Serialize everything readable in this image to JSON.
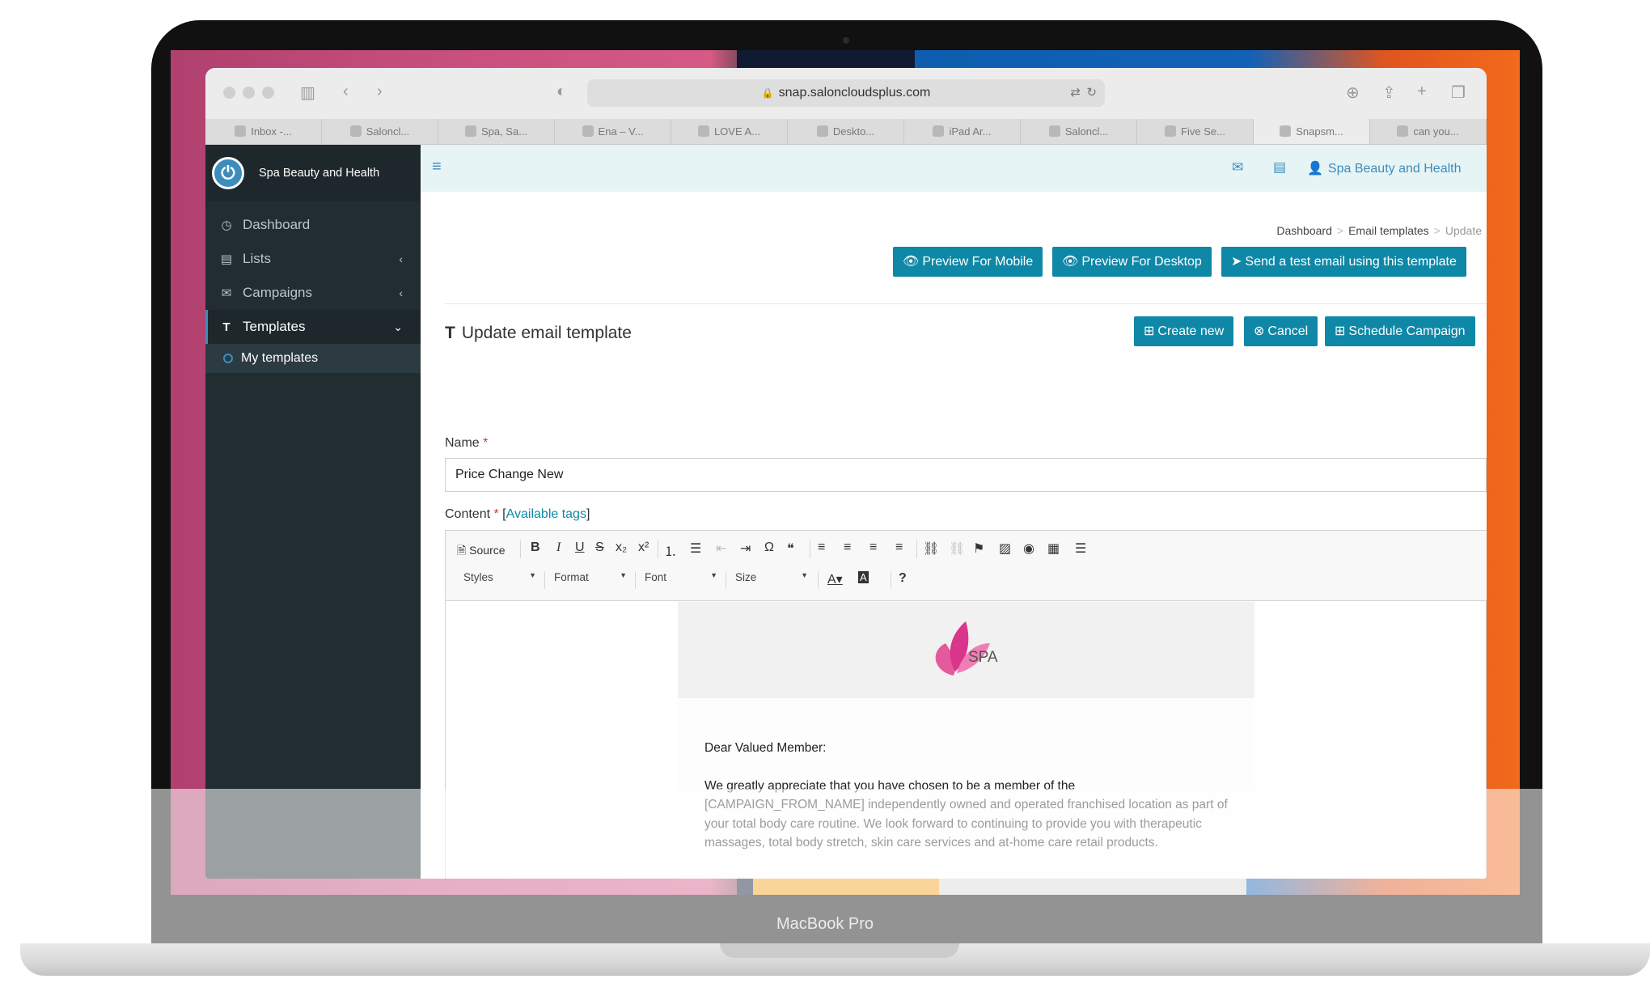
{
  "device": {
    "label": "MacBook Pro"
  },
  "browser": {
    "url": "snap.saloncloudsplus.com",
    "tabs": [
      {
        "label": "Inbox -..."
      },
      {
        "label": "Saloncl..."
      },
      {
        "label": "Spa, Sa..."
      },
      {
        "label": "Ena – V..."
      },
      {
        "label": "LOVE A..."
      },
      {
        "label": "Deskto..."
      },
      {
        "label": "iPad Ar..."
      },
      {
        "label": "Saloncl..."
      },
      {
        "label": "Five Se..."
      },
      {
        "label": "Snapsm..."
      },
      {
        "label": "can you..."
      }
    ],
    "active_tab_index": 9
  },
  "brand": {
    "name": "Spa Beauty and Health"
  },
  "sidebar": {
    "items": [
      {
        "label": "Dashboard",
        "icon": "clock-icon"
      },
      {
        "label": "Lists",
        "icon": "list-icon"
      },
      {
        "label": "Campaigns",
        "icon": "envelope-icon"
      },
      {
        "label": "Templates",
        "icon": "text-icon"
      }
    ],
    "sub_items": [
      {
        "label": "My templates"
      }
    ]
  },
  "topbar": {
    "user_name": "Spa Beauty and Health"
  },
  "breadcrumb": {
    "items": [
      "Dashboard",
      "Email templates",
      "Update"
    ]
  },
  "actions": {
    "preview_mobile": "Preview For Mobile",
    "preview_desktop": "Preview For Desktop",
    "send_test": "Send a test email using this template",
    "create_new": "Create new",
    "cancel": "Cancel",
    "schedule": "Schedule Campaign"
  },
  "form": {
    "title": "Update email template",
    "name_label": "Name",
    "required_mark": "*",
    "name_value": "Price Change New",
    "content_label": "Content",
    "available_tags": "Available tags"
  },
  "editor": {
    "source_label": "Source",
    "combos": {
      "styles": "Styles",
      "format": "Format",
      "font": "Font",
      "size": "Size"
    }
  },
  "email": {
    "logo_text": "SPA",
    "greeting": "Dear Valued Member:",
    "body": "We greatly appreciate that you have chosen to be a member of the [CAMPAIGN_FROM_NAME] independently owned and operated franchised location as part of your total body care routine. We look forward to continuing to provide you with therapeutic massages, total body stretch, skin care services and at-home care retail products."
  },
  "colors": {
    "accent": "#0f88a7",
    "sidebar_bg": "#222d32",
    "topbar_bg": "#e6f4f6",
    "brand_logo": "#3c8dbc",
    "required": "#d73925"
  }
}
